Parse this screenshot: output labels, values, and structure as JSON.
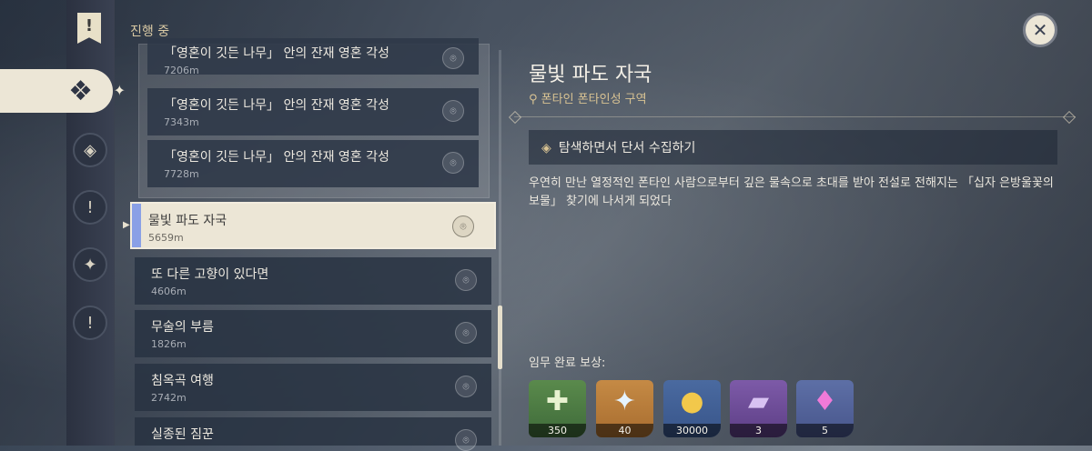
{
  "sidebar": {
    "section_label": "진행 중",
    "items": [
      {
        "icon": "banner-exclamation-icon",
        "glyph": "!"
      },
      {
        "icon": "quest-diamond-icon",
        "glyph": "❖"
      },
      {
        "icon": "archon-quest-icon",
        "glyph": "◈"
      },
      {
        "icon": "exclamation-icon-1",
        "glyph": "!"
      },
      {
        "icon": "compass-icon",
        "glyph": "✦"
      },
      {
        "icon": "exclamation-icon-2",
        "glyph": "!"
      }
    ]
  },
  "quests": [
    {
      "name": "「영혼이 깃든 나무」 안의 잔재 영혼 각성",
      "distance": "7206m"
    },
    {
      "name": "「영혼이 깃든 나무」 안의 잔재 영혼 각성",
      "distance": "7343m"
    },
    {
      "name": "「영혼이 깃든 나무」 안의 잔재 영혼 각성",
      "distance": "7728m"
    },
    {
      "name": "물빛 파도 자국",
      "distance": "5659m"
    },
    {
      "name": "또 다른 고향이 있다면",
      "distance": "4606m"
    },
    {
      "name": "무술의 부름",
      "distance": "1826m"
    },
    {
      "name": "침옥곡 여행",
      "distance": "2742m"
    },
    {
      "name": "실종된 짐꾼",
      "distance": ""
    }
  ],
  "detail": {
    "title": "물빛 파도 자국",
    "location": "폰타인 폰타인성 구역",
    "objective": "탐색하면서 단서 수집하기",
    "description": "우연히 만난 열정적인 폰타인 사람으로부터 깊은 물속으로 초대를 받아 전설로 전해지는 「십자 은방울꽃의 보물」 찾기에 나서게 되었다",
    "reward_label": "임무 완료 보상:",
    "rewards": [
      {
        "icon": "adventure-exp-icon",
        "count": "350"
      },
      {
        "icon": "primogem-icon",
        "count": "40"
      },
      {
        "icon": "mora-icon",
        "count": "30000"
      },
      {
        "icon": "heros-wit-book-icon",
        "count": "3"
      },
      {
        "icon": "mystic-ore-crystal-icon",
        "count": "5"
      }
    ]
  },
  "colors": {
    "accent": "#8aa0e6",
    "selected_bg": "#ece6d6",
    "location_text": "#d9c393"
  }
}
